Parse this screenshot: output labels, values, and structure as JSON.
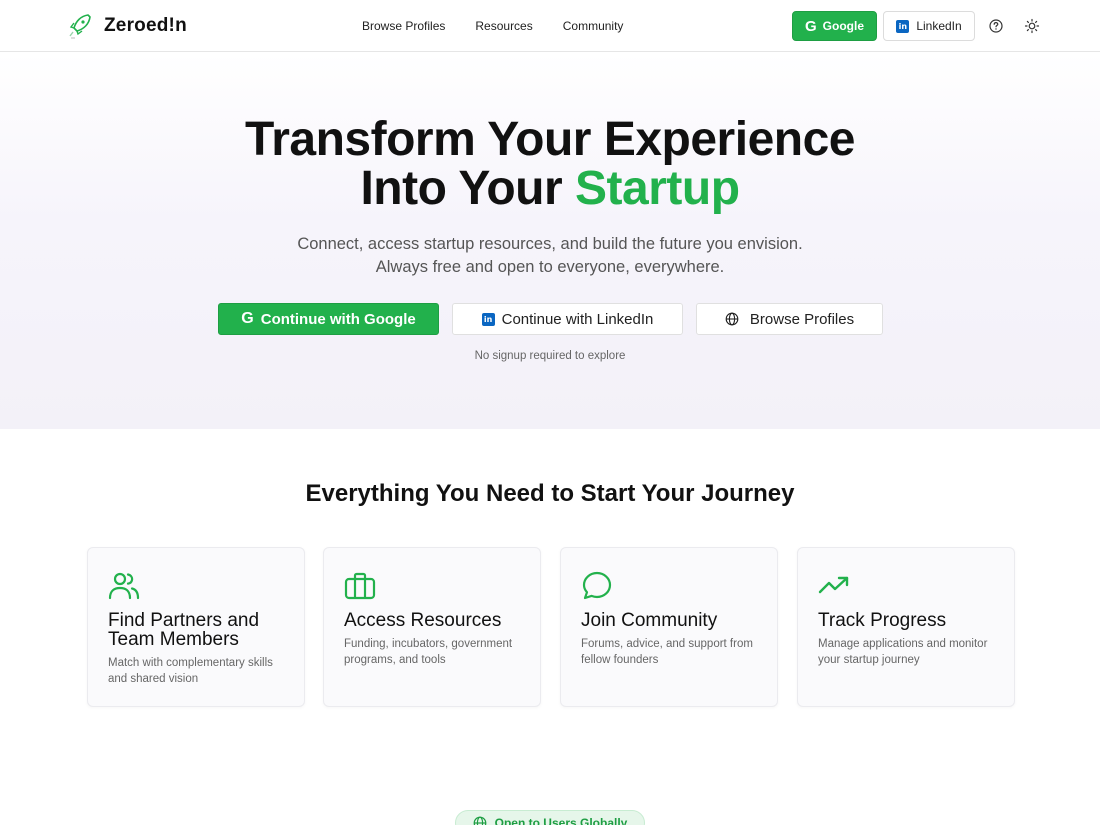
{
  "header": {
    "brand": "Zeroed!n",
    "nav": [
      "Browse Profiles",
      "Resources",
      "Community"
    ],
    "google_label": "Google",
    "linkedin_label": "LinkedIn"
  },
  "hero": {
    "title_line1": "Transform Your Experience",
    "title_line2_prefix": "Into Your ",
    "title_line2_accent": "Startup",
    "subtitle_line1": "Connect, access startup resources, and build the future you envision.",
    "subtitle_line2": "Always free and open to everyone, everywhere.",
    "cta_google": "Continue with Google",
    "cta_linkedin": "Continue with LinkedIn",
    "cta_browse": "Browse Profiles",
    "note": "No signup required to explore"
  },
  "features": {
    "title": "Everything You Need to Start Your Journey",
    "cards": [
      {
        "icon": "users-icon",
        "title": "Find Partners and Team Members",
        "desc": "Match with complementary skills and shared vision"
      },
      {
        "icon": "briefcase-icon",
        "title": "Access Resources",
        "desc": "Funding, incubators, government programs, and tools"
      },
      {
        "icon": "chat-bubble-icon",
        "title": "Join Community",
        "desc": "Forums, advice, and support from fellow founders"
      },
      {
        "icon": "trending-up-icon",
        "title": "Track Progress",
        "desc": "Manage applications and monitor your startup journey"
      }
    ]
  },
  "badge": {
    "label": "Open to Users Globally"
  },
  "colors": {
    "accent": "#22b14c",
    "linkedin": "#0a66c2"
  }
}
